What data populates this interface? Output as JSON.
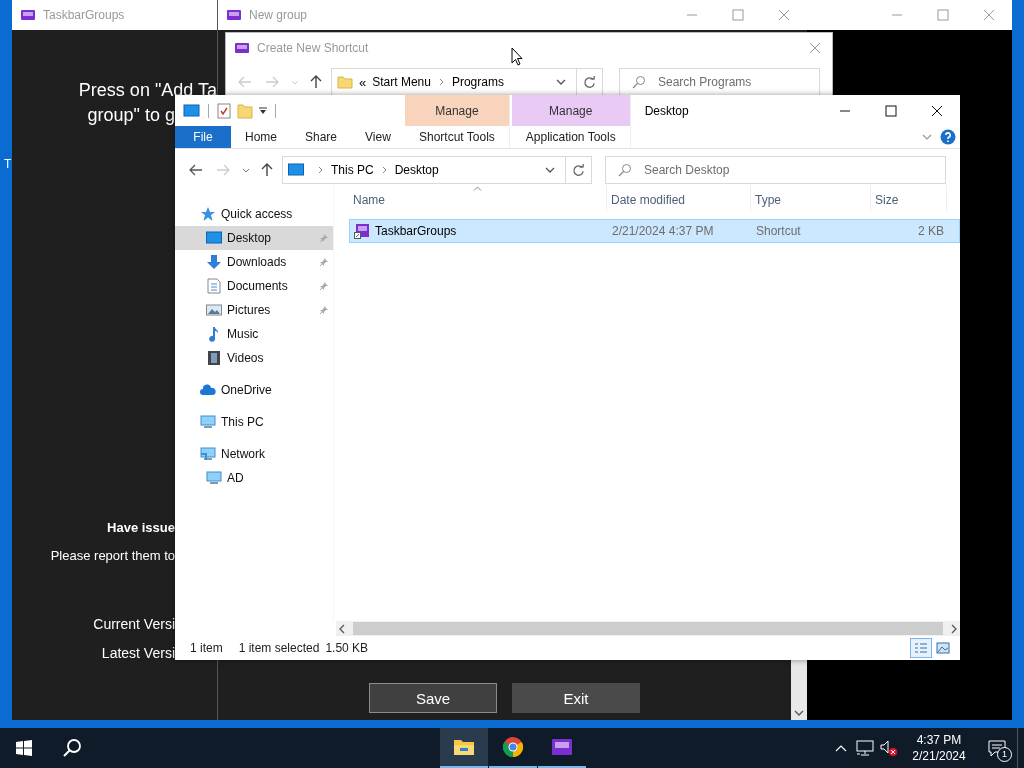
{
  "desktop": {
    "icon_label": "T"
  },
  "main_window": {
    "title": "TaskbarGroups",
    "intro_lines": [
      "Press on \"Add Ta",
      "group\" to g"
    ],
    "issues_heading": "Have issue",
    "issues_text": "Please report them to",
    "version_lines": [
      "Current Versi",
      "Latest Versi"
    ]
  },
  "group_window": {
    "title": "New group",
    "buttons": [
      {
        "label": "Save",
        "focused": true
      },
      {
        "label": "Exit",
        "focused": false
      }
    ]
  },
  "shortcut_dialog": {
    "title": "Create New Shortcut",
    "overflow_mark": "«",
    "address": [
      "Start Menu",
      "Programs"
    ],
    "search": {
      "placeholder": "Search Programs"
    }
  },
  "explorer": {
    "title": "Desktop",
    "ribbon_tabs": [
      {
        "label": "File",
        "kind": "file"
      },
      {
        "label": "Home",
        "kind": "tab"
      },
      {
        "label": "Share",
        "kind": "tab"
      },
      {
        "label": "View",
        "kind": "tab"
      }
    ],
    "context_tabs": [
      {
        "group": "Manage",
        "label": "Shortcut Tools",
        "color": "#f9d4bd"
      },
      {
        "group": "Manage",
        "label": "Application Tools",
        "color": "#e9caf5"
      }
    ],
    "address": [
      "This PC",
      "Desktop"
    ],
    "search": {
      "placeholder": "Search Desktop"
    },
    "sidebar": [
      {
        "label": "Quick access",
        "kind": "star",
        "selected": false,
        "children": [
          {
            "label": "Desktop",
            "kind": "desktop",
            "selected": true,
            "pinned": true
          },
          {
            "label": "Downloads",
            "kind": "downloads",
            "selected": false,
            "pinned": true
          },
          {
            "label": "Documents",
            "kind": "documents",
            "selected": false,
            "pinned": true
          },
          {
            "label": "Pictures",
            "kind": "pictures",
            "selected": false,
            "pinned": true
          },
          {
            "label": "Music",
            "kind": "music",
            "selected": false,
            "pinned": false
          },
          {
            "label": "Videos",
            "kind": "videos",
            "selected": false,
            "pinned": false
          }
        ]
      },
      {
        "label": "OneDrive",
        "kind": "cloud",
        "selected": false
      },
      {
        "label": "This PC",
        "kind": "pc",
        "selected": false
      },
      {
        "label": "Network",
        "kind": "network",
        "selected": false,
        "children": [
          {
            "label": "AD",
            "kind": "pc",
            "selected": false,
            "pinned": false
          }
        ]
      }
    ],
    "columns": [
      {
        "label": "Name",
        "sorted": true
      },
      {
        "label": "Date modified",
        "sorted": false
      },
      {
        "label": "Type",
        "sorted": false
      },
      {
        "label": "Size",
        "sorted": false
      }
    ],
    "rows": [
      {
        "name": "TaskbarGroups",
        "date": "2/21/2024 4:37 PM",
        "type": "Shortcut",
        "size": "2 KB",
        "selected": true
      }
    ],
    "status": {
      "count": "1 item",
      "selection": "1 item selected",
      "size": "1.50 KB"
    },
    "views": [
      {
        "kind": "details",
        "selected": true
      },
      {
        "kind": "large-icons",
        "selected": false
      }
    ]
  },
  "taskbar": {
    "apps": [
      {
        "kind": "explorer",
        "selected": true
      },
      {
        "kind": "chrome",
        "selected": false
      },
      {
        "kind": "taskbargroups",
        "selected": false
      }
    ],
    "time": "4:37 PM",
    "date": "2/21/2024",
    "notifications": "1"
  }
}
